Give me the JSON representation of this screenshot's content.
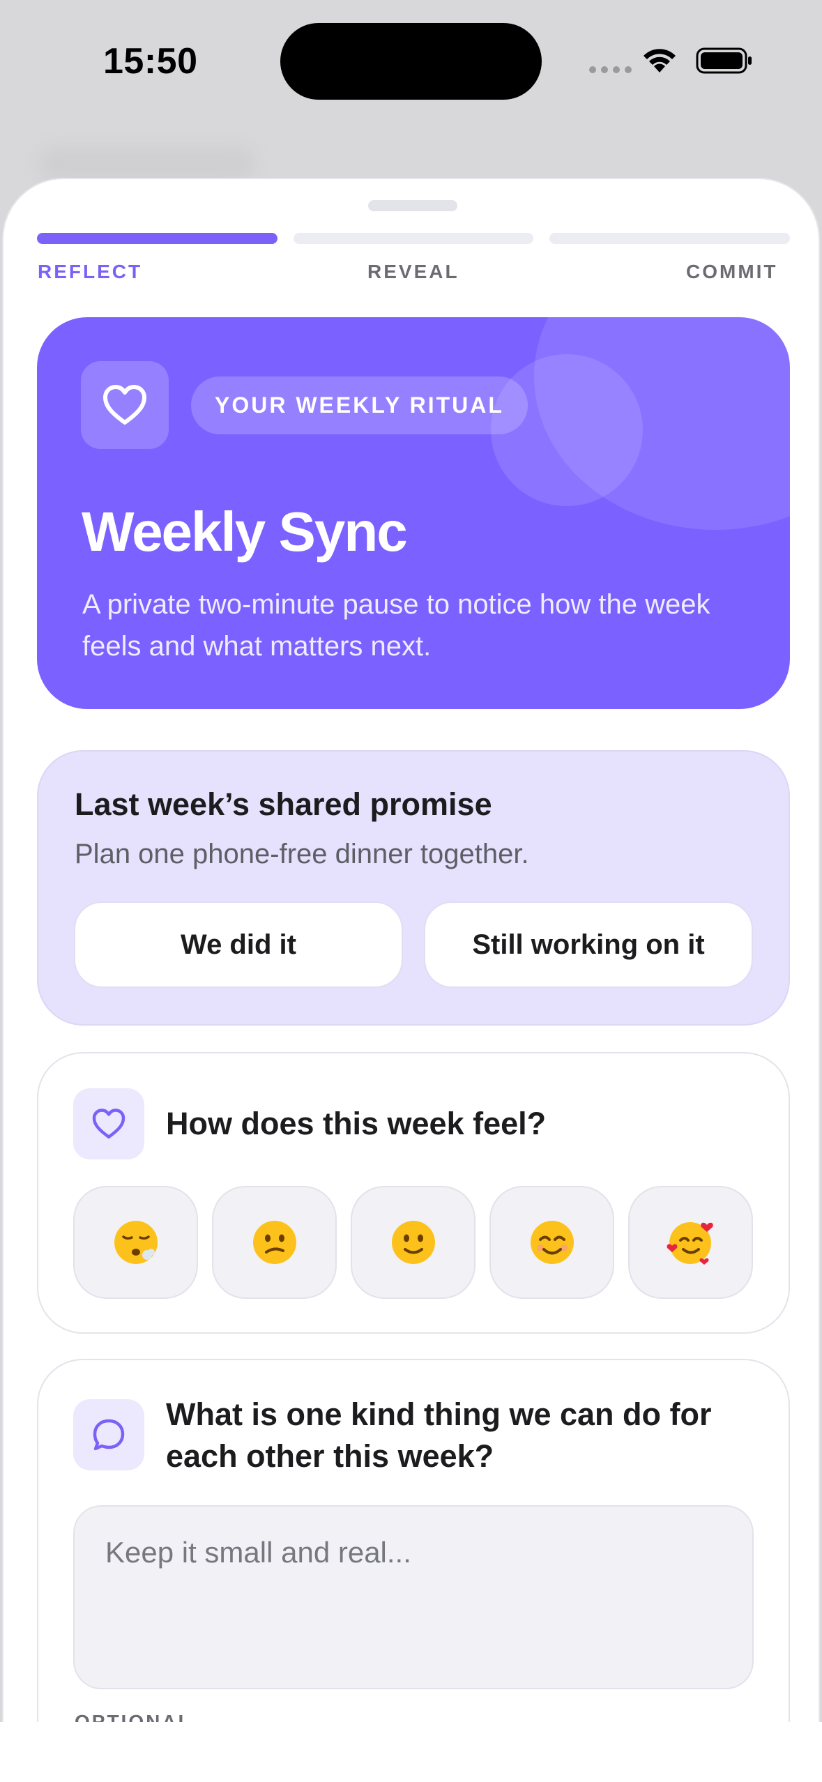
{
  "status": {
    "time": "15:50"
  },
  "steps": [
    {
      "label": "REFLECT",
      "active": true
    },
    {
      "label": "REVEAL",
      "active": false
    },
    {
      "label": "COMMIT",
      "active": false
    }
  ],
  "hero": {
    "badge": "YOUR WEEKLY RITUAL",
    "title": "Weekly Sync",
    "subtitle": "A private two-minute pause to notice how the week feels and what matters next.",
    "icon": "heart-icon"
  },
  "promise": {
    "title": "Last week’s shared promise",
    "text": "Plan one phone-free dinner together.",
    "done_label": "We did it",
    "working_label": "Still working on it"
  },
  "mood": {
    "question": "How does this week feel?",
    "icon": "heart-icon",
    "options": [
      "exhausted",
      "confused",
      "slightly-smiling",
      "smiling",
      "loving"
    ]
  },
  "kindness": {
    "question": "What is one kind thing we can do for each other this week?",
    "icon": "chat-bubble-icon",
    "placeholder": "Keep it small and real...",
    "optional_label": "OPTIONAL"
  },
  "colors": {
    "accent": "#7b61ff",
    "promise_bg": "#e6e1fd",
    "sheet_bg": "#ffffff"
  }
}
